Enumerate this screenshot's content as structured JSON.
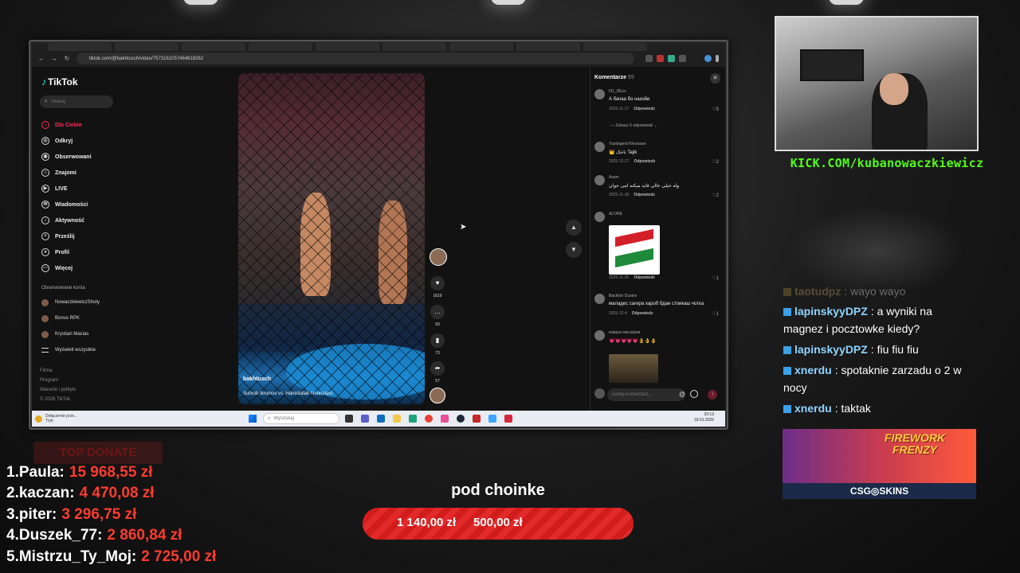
{
  "browser": {
    "url": "tiktok.com/@bakhtusch/video/7573161057464618262"
  },
  "tiktok": {
    "logo": "TikTok",
    "search_placeholder": "Szukaj",
    "nav": [
      {
        "label": "Dla Ciebie",
        "icon": "home-icon"
      },
      {
        "label": "Odkryj",
        "icon": "compass-icon"
      },
      {
        "label": "Obserwowani",
        "icon": "following-icon"
      },
      {
        "label": "Znajomi",
        "icon": "friends-icon"
      },
      {
        "label": "LIVE",
        "icon": "live-icon"
      },
      {
        "label": "Wiadomości",
        "icon": "messages-icon"
      },
      {
        "label": "Aktywność",
        "icon": "activity-icon"
      },
      {
        "label": "Prześlij",
        "icon": "upload-icon"
      },
      {
        "label": "Profil",
        "icon": "profile-icon"
      },
      {
        "label": "Więcej",
        "icon": "more-icon"
      }
    ],
    "following_title": "Obserwowane konta",
    "following": [
      {
        "name": "NowaczkiewiczShoty"
      },
      {
        "name": "Bonus RPK"
      },
      {
        "name": "Krystian Macias"
      },
      {
        "name": "Wyświetl wszystkie"
      }
    ],
    "footer": [
      "Firma",
      "Program",
      "Warunki i polityki",
      "© 2026 TikTok"
    ],
    "video": {
      "author": "bakhtusch",
      "caption": "Suhrob Ikromov vs. Hamidullah Nooristani"
    },
    "actions": {
      "likes": "1619",
      "comments": "69",
      "saves": "73",
      "shares": "57"
    },
    "comments": {
      "title": "Komentarze",
      "count": "69",
      "items": [
        {
          "user": "FD_DEoх",
          "text": "А бачаа бо назойи",
          "date": "2025-11-17",
          "reply": "Odpowiedz",
          "likes": "5"
        },
        {
          "user": "Yazdegerd Khorasan",
          "text": "👑 تاجک Tajik",
          "date": "2025-12-27",
          "reply": "Odpowiedz",
          "likes": "2"
        },
        {
          "user": "Azam",
          "text": "وله خیلی عالی فاید میکنه امی جوان",
          "date": "2025-11-18",
          "reply": "Odpowiedz",
          "likes": "2"
        },
        {
          "user": "ALONE",
          "text": "",
          "date": "2025-11-20",
          "reply": "Odpowiedz",
          "likes": "1"
        },
        {
          "user": "Bachtior Dustov",
          "text": "маладес сагера хароб бдаи стоикаш чотка",
          "date": "2025-12-4",
          "reply": "Odpowiedz",
          "likes": "1"
        },
        {
          "user": "комрон киссиров",
          "text": "💗💗💗💗💗👌👌👌",
          "date": "",
          "reply": "",
          "likes": ""
        }
      ],
      "view_replies": "Zobacz 5 odpowiedzi",
      "input_placeholder": "Dodaj komentarz..."
    }
  },
  "taskbar": {
    "notification": "Dołączenie prze...",
    "notification_sub": "Tryb",
    "search_placeholder": "Wyszukaj",
    "time": "20:13",
    "date": "18.01.2026"
  },
  "stream": {
    "kick_handle": "KICK.COM/kubanowaczkiewicz",
    "chat": [
      {
        "nick": "taotudpz",
        "message": ": wayo wayo",
        "color": "#c7a56a",
        "faded": true
      },
      {
        "nick": "lapinskyyDPZ",
        "message": ": a wyniki na magnez i pocztowke kiedy?",
        "color": "#8fd3ff",
        "faded": false
      },
      {
        "nick": "lapinskyyDPZ",
        "message": ": fiu fiu fiu",
        "color": "#8fd3ff",
        "faded": false
      },
      {
        "nick": "xnerdu",
        "message": ": spotaknie zarzadu o 2 w nocy",
        "color": "#8fd3ff",
        "faded": false
      },
      {
        "nick": "xnerdu",
        "message": ": taktak",
        "color": "#8fd3ff",
        "faded": false
      }
    ],
    "ad": {
      "title": "FIREWORK FRENZY",
      "brand": "CSG◎SKINS"
    },
    "top_donate": {
      "title": "TOP DONATE",
      "entries": [
        {
          "rank": "1.",
          "name": "Paula:",
          "amount": "15 968,55 zł"
        },
        {
          "rank": "2.",
          "name": "kaczan:",
          "amount": "4 470,08 zł"
        },
        {
          "rank": "3.",
          "name": "piter:",
          "amount": "3 296,75 zł"
        },
        {
          "rank": "4.",
          "name": "Duszek_77:",
          "amount": "2 860,84 zł"
        },
        {
          "rank": "5.",
          "name": "Mistrzu_Ty_Moj:",
          "amount": "2 725,00 zł"
        }
      ]
    },
    "goal": {
      "title": "pod choinke",
      "current": "1 140,00 zł",
      "target": "500,00 zł",
      "progress": 1.0
    }
  },
  "colors": {
    "tiktok_accent": "#fe2c55",
    "kick_green": "#53fc18",
    "donate_red": "#ff3b30"
  }
}
